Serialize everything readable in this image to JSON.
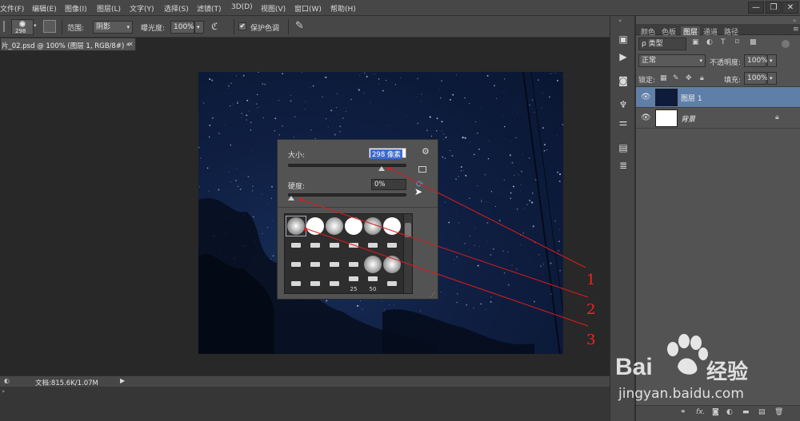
{
  "menu": {
    "items": [
      "文件(F)",
      "编辑(E)",
      "图像(I)",
      "图层(L)",
      "文字(Y)",
      "选择(S)",
      "滤镜(T)",
      "3D(D)",
      "视图(V)",
      "窗口(W)",
      "帮助(H)"
    ],
    "window_buttons": [
      "—",
      "❐",
      "✕"
    ]
  },
  "options_bar": {
    "brush_size": "298",
    "range_label": "范围:",
    "range_value": "阴影",
    "exposure_label": "曝光度:",
    "exposure_value": "100%",
    "protect_tone_label": "保护色调",
    "protect_tone_checked": true
  },
  "document": {
    "tab_title": "片_02.psd @ 100% (图层 1, RGB/8#) *",
    "close_glyph": "✕"
  },
  "brush_popup": {
    "size_label": "大小:",
    "size_value": "298 像素",
    "size_fraction": 0.79,
    "hardness_label": "硬度:",
    "hardness_value": "0%",
    "hardness_fraction": 0.0,
    "gear_icon": "gear-icon",
    "brush_labels": [
      "25",
      "50"
    ]
  },
  "status": {
    "doc_info": "文档:815.6K/1.07M"
  },
  "layers_panel": {
    "tabs": [
      "颜色",
      "色板",
      "图层",
      "通道",
      "路径"
    ],
    "active_tab": "图层",
    "filter_label": "ρ 类型",
    "blend_mode": "正常",
    "opacity_label": "不透明度:",
    "opacity_value": "100%",
    "lock_label": "锁定:",
    "fill_label": "填充:",
    "fill_value": "100%",
    "layers": [
      {
        "name": "图层 1",
        "selected": true
      },
      {
        "name": "背景",
        "selected": false
      }
    ],
    "bottom_icons": [
      "link-icon",
      "fx-icon",
      "mask-icon",
      "adjustment-icon",
      "folder-icon",
      "new-layer-icon",
      "trash-icon"
    ]
  },
  "annotations": [
    "1",
    "2",
    "3"
  ],
  "watermark": {
    "brand": "Bai",
    "brand_cn": "经验",
    "url": "jingyan.baidu.com"
  },
  "colors": {
    "menubar": "#474747",
    "panel": "#535353",
    "workspace": "#282828",
    "selection": "#5f7fa8",
    "annotation": "#ff1f1f"
  }
}
